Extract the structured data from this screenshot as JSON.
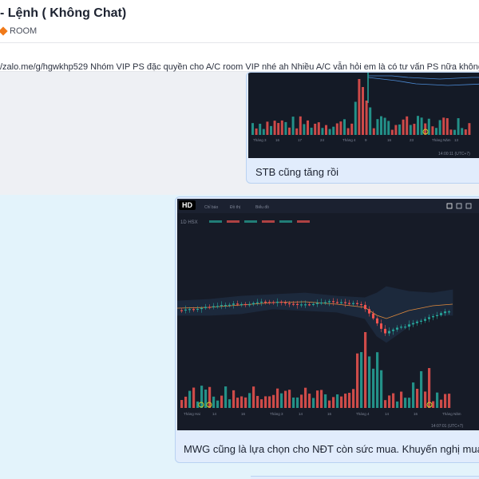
{
  "header": {
    "title": "- Lệnh ( Không Chat)",
    "badge_label": "ROOM",
    "badge_color": "#f07a1a",
    "badge_icon": "diamond-icon"
  },
  "pinned": {
    "text": "/zalo.me/g/hgwkhp529 Nhóm VIP PS đặc quyền cho A/C room VIP nhé ah Nhiều A/C vẫn hỏi em là có tư vấn PS nữa không? em"
  },
  "messages": [
    {
      "caption": "STB cũng tăng rồi",
      "chart": {
        "x_ticks": [
          "Tháng 3",
          "16",
          "17",
          "24",
          "Tháng 4",
          "9",
          "16",
          "23",
          "Tháng Năm",
          "13"
        ],
        "timestamp": "14:00:11 (UTC+7)"
      }
    },
    {
      "caption": "MWG cũng là lựa chọn cho NĐT còn sức mua. Khuyến nghị mua cổ p",
      "hd_label": "HD",
      "chart": {
        "symbol_line": "1D HSX",
        "toolbar": [
          "Chỉ báo",
          "Đồ thị",
          "Biểu đồ"
        ],
        "x_ticks": [
          "Tháng Hai",
          "14",
          "16",
          "Tháng 3",
          "14",
          "16",
          "Tháng 4",
          "14",
          "16",
          "Tháng Năm"
        ],
        "timestamp": "14:07:01 (UTC+7)"
      }
    }
  ],
  "colors": {
    "up": "#26a69a",
    "down": "#ef5350",
    "band": "#4c8bd6",
    "chat_bg": "#e3f3fb",
    "bubble_bg": "#e1ecfc"
  }
}
